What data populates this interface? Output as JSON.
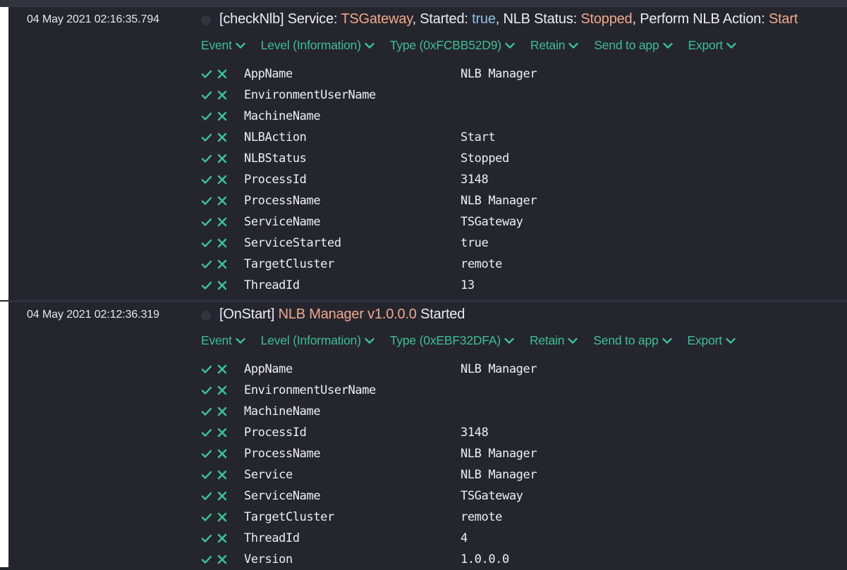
{
  "events": [
    {
      "timestamp": "04 May 2021  02:16:35.794",
      "title_parts": [
        {
          "text": "[checkNlb] Service: ",
          "style": "plain"
        },
        {
          "text": "TSGateway",
          "style": "orange"
        },
        {
          "text": ", Started: ",
          "style": "plain"
        },
        {
          "text": "true",
          "style": "blue"
        },
        {
          "text": ", NLB Status: ",
          "style": "plain"
        },
        {
          "text": "Stopped",
          "style": "orange"
        },
        {
          "text": ", Perform NLB Action: ",
          "style": "plain"
        },
        {
          "text": "Start",
          "style": "orange"
        }
      ],
      "actions": [
        {
          "label": "Event"
        },
        {
          "label": "Level (Information)"
        },
        {
          "label": "Type (0xFCBB52D9)"
        },
        {
          "label": "Retain"
        },
        {
          "label": "Send to app"
        },
        {
          "label": "Export"
        }
      ],
      "properties": [
        {
          "name": "AppName",
          "value": "NLB Manager"
        },
        {
          "name": "EnvironmentUserName",
          "value": ""
        },
        {
          "name": "MachineName",
          "value": ""
        },
        {
          "name": "NLBAction",
          "value": "Start"
        },
        {
          "name": "NLBStatus",
          "value": "Stopped"
        },
        {
          "name": "ProcessId",
          "value": "3148"
        },
        {
          "name": "ProcessName",
          "value": "NLB Manager"
        },
        {
          "name": "ServiceName",
          "value": "TSGateway"
        },
        {
          "name": "ServiceStarted",
          "value": "true"
        },
        {
          "name": "TargetCluster",
          "value": "remote"
        },
        {
          "name": "ThreadId",
          "value": "13"
        }
      ]
    },
    {
      "timestamp": "04 May 2021  02:12:36.319",
      "title_parts": [
        {
          "text": "[OnStart] ",
          "style": "plain"
        },
        {
          "text": "NLB Manager",
          "style": "orange"
        },
        {
          "text": " ",
          "style": "plain"
        },
        {
          "text": "v1.0.0.0",
          "style": "orange"
        },
        {
          "text": " Started",
          "style": "plain"
        }
      ],
      "actions": [
        {
          "label": "Event"
        },
        {
          "label": "Level (Information)"
        },
        {
          "label": "Type (0xEBF32DFA)"
        },
        {
          "label": "Retain"
        },
        {
          "label": "Send to app"
        },
        {
          "label": "Export"
        }
      ],
      "properties": [
        {
          "name": "AppName",
          "value": "NLB Manager"
        },
        {
          "name": "EnvironmentUserName",
          "value": ""
        },
        {
          "name": "MachineName",
          "value": ""
        },
        {
          "name": "ProcessId",
          "value": "3148"
        },
        {
          "name": "ProcessName",
          "value": "NLB Manager"
        },
        {
          "name": "Service",
          "value": "NLB Manager"
        },
        {
          "name": "ServiceName",
          "value": "TSGateway"
        },
        {
          "name": "TargetCluster",
          "value": "remote"
        },
        {
          "name": "ThreadId",
          "value": "4"
        },
        {
          "name": "Version",
          "value": "1.0.0.0"
        }
      ]
    }
  ],
  "icons": {
    "include": "check-icon",
    "exclude": "x-icon",
    "expand": "chevron-down-icon",
    "level": "level-dot-icon"
  },
  "colors": {
    "background": "#25252e",
    "action_green": "#3dbf95",
    "highlight_orange": "#f0a98b",
    "highlight_blue": "#8fc3e8",
    "text": "#ecedf3"
  }
}
